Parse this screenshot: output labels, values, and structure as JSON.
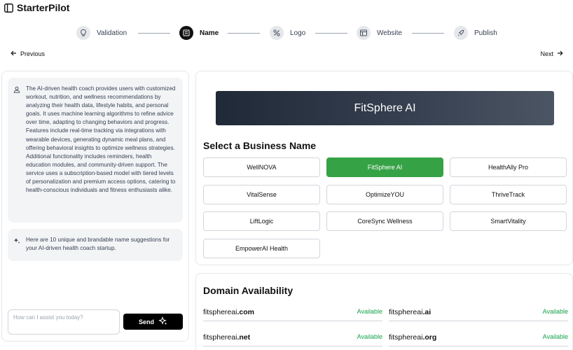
{
  "app": {
    "title": "StarterPilot",
    "icon": "sidebar-panel-icon"
  },
  "stepper": {
    "steps": [
      {
        "label": "Validation",
        "icon": "lightbulb-icon",
        "active": false
      },
      {
        "label": "Name",
        "icon": "book-icon",
        "active": true
      },
      {
        "label": "Logo",
        "icon": "tools-icon",
        "active": false
      },
      {
        "label": "Website",
        "icon": "layout-icon",
        "active": false
      },
      {
        "label": "Publish",
        "icon": "rocket-icon",
        "active": false
      }
    ]
  },
  "nav": {
    "previous": "Previous",
    "next": "Next"
  },
  "chat": {
    "user_message": "The AI-driven health coach provides users with customized workout, nutrition, and wellness recommendations by analyzing their health data, lifestyle habits, and personal goals. It uses machine learning algorithms to refine advice over time, adapting to changing behaviors and progress. Features include real-time tracking via integrations with wearable devices, generating dynamic meal plans, and offering behavioral insights to optimize wellness strategies. Additional functionality includes reminders, health education modules, and community-driven support. The service uses a subscription-based model with tiered levels of personalization and premium access options, catering to health-conscious individuals and fitness enthusiasts alike.",
    "assistant_message": "Here are 10 unique and brandable name suggestions for your AI-driven health coach startup.",
    "input_placeholder": "How can I assist you today?",
    "input_value": "",
    "send_label": "Send"
  },
  "business": {
    "banner": "FitSphere AI",
    "section_title": "Select a Business Name",
    "names": [
      "WellNOVA",
      "FitSphere AI",
      "HealthAlly Pro",
      "VitalSense",
      "OptimizeYOU",
      "ThriveTrack",
      "LiftLogic",
      "CoreSync Wellness",
      "SmartVitality",
      "EmpowerAI Health"
    ],
    "selected": "FitSphere AI"
  },
  "domains": {
    "section_title": "Domain Availability",
    "items": [
      {
        "base": "fitsphereai",
        "tld": ".com",
        "status": "Available"
      },
      {
        "base": "fitsphereai",
        "tld": ".ai",
        "status": "Available"
      },
      {
        "base": "fitsphereai",
        "tld": ".net",
        "status": "Available"
      },
      {
        "base": "fitsphereai",
        "tld": ".org",
        "status": "Available"
      }
    ]
  },
  "colors": {
    "selected": "#36a246",
    "available": "#16a34a",
    "banner_dark": "#1f2937",
    "active_step": "#111111"
  }
}
